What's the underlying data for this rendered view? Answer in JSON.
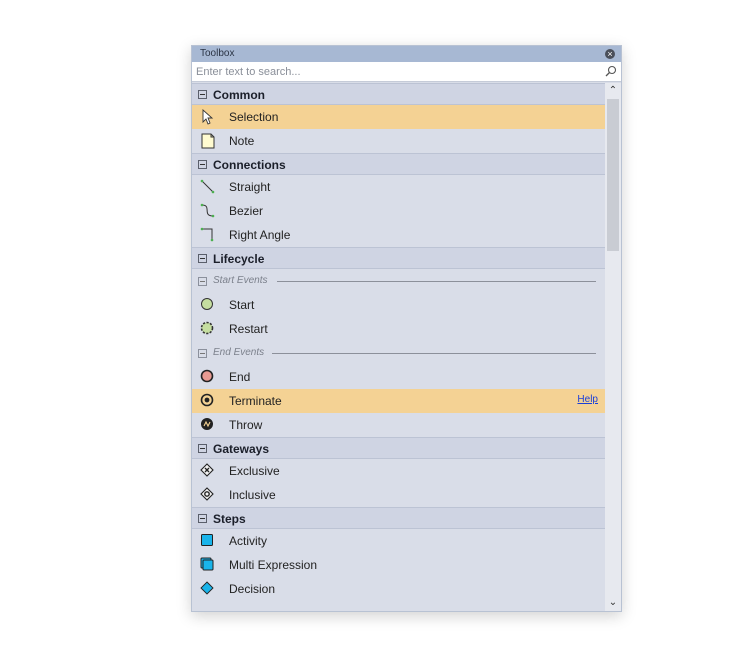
{
  "toolbox": {
    "title": "Toolbox",
    "search_placeholder": "Enter text to search...",
    "categories": [
      {
        "label": "Common",
        "items": [
          {
            "label": "Selection",
            "icon": "pointer-icon",
            "selected": true
          },
          {
            "label": "Note",
            "icon": "note-icon"
          }
        ]
      },
      {
        "label": "Connections",
        "items": [
          {
            "label": "Straight",
            "icon": "straight-connector-icon"
          },
          {
            "label": "Bezier",
            "icon": "bezier-connector-icon"
          },
          {
            "label": "Right Angle",
            "icon": "right-angle-connector-icon"
          }
        ]
      },
      {
        "label": "Lifecycle",
        "subgroups": [
          {
            "label": "Start Events",
            "items": [
              {
                "label": "Start",
                "icon": "start-event-icon"
              },
              {
                "label": "Restart",
                "icon": "restart-event-icon"
              }
            ]
          },
          {
            "label": "End Events",
            "items": [
              {
                "label": "End",
                "icon": "end-event-icon"
              },
              {
                "label": "Terminate",
                "icon": "terminate-event-icon",
                "selected": true,
                "help": "Help"
              },
              {
                "label": "Throw",
                "icon": "throw-event-icon"
              }
            ]
          }
        ]
      },
      {
        "label": "Gateways",
        "items": [
          {
            "label": "Exclusive",
            "icon": "exclusive-gateway-icon"
          },
          {
            "label": "Inclusive",
            "icon": "inclusive-gateway-icon"
          }
        ]
      },
      {
        "label": "Steps",
        "items": [
          {
            "label": "Activity",
            "icon": "activity-icon"
          },
          {
            "label": "Multi Expression",
            "icon": "multi-expression-icon"
          },
          {
            "label": "Decision",
            "icon": "decision-icon"
          }
        ]
      }
    ]
  },
  "colors": {
    "selection": "#f4d294",
    "panel": "#d9dde8",
    "category_header": "#cfd4e3",
    "titlebar": "#a7b8d3",
    "link": "#1a3fd9"
  }
}
